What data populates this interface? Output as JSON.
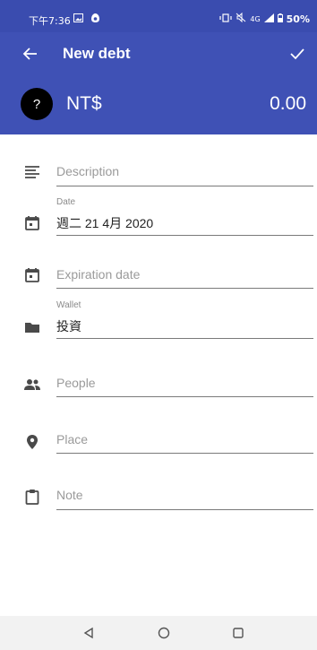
{
  "status_bar": {
    "time": "下午7:36",
    "battery": "50%",
    "network": "4G"
  },
  "app_bar": {
    "title": "New debt",
    "currency_avatar": "?",
    "currency": "NT$",
    "amount": "0.00"
  },
  "form": {
    "description": {
      "placeholder": "Description",
      "icon": "notes-icon"
    },
    "date": {
      "label": "Date",
      "value": "週二 21 4月 2020",
      "icon": "calendar-icon"
    },
    "expiration": {
      "placeholder": "Expiration date",
      "icon": "calendar-icon"
    },
    "wallet": {
      "label": "Wallet",
      "value": "投資",
      "icon": "folder-icon"
    },
    "people": {
      "placeholder": "People",
      "icon": "people-icon"
    },
    "place": {
      "placeholder": "Place",
      "icon": "location-icon"
    },
    "note": {
      "placeholder": "Note",
      "icon": "clipboard-icon"
    }
  },
  "colors": {
    "status_bar": "#3a4caf",
    "app_bar": "#3f51b5",
    "icon": "#4a4a4a"
  }
}
